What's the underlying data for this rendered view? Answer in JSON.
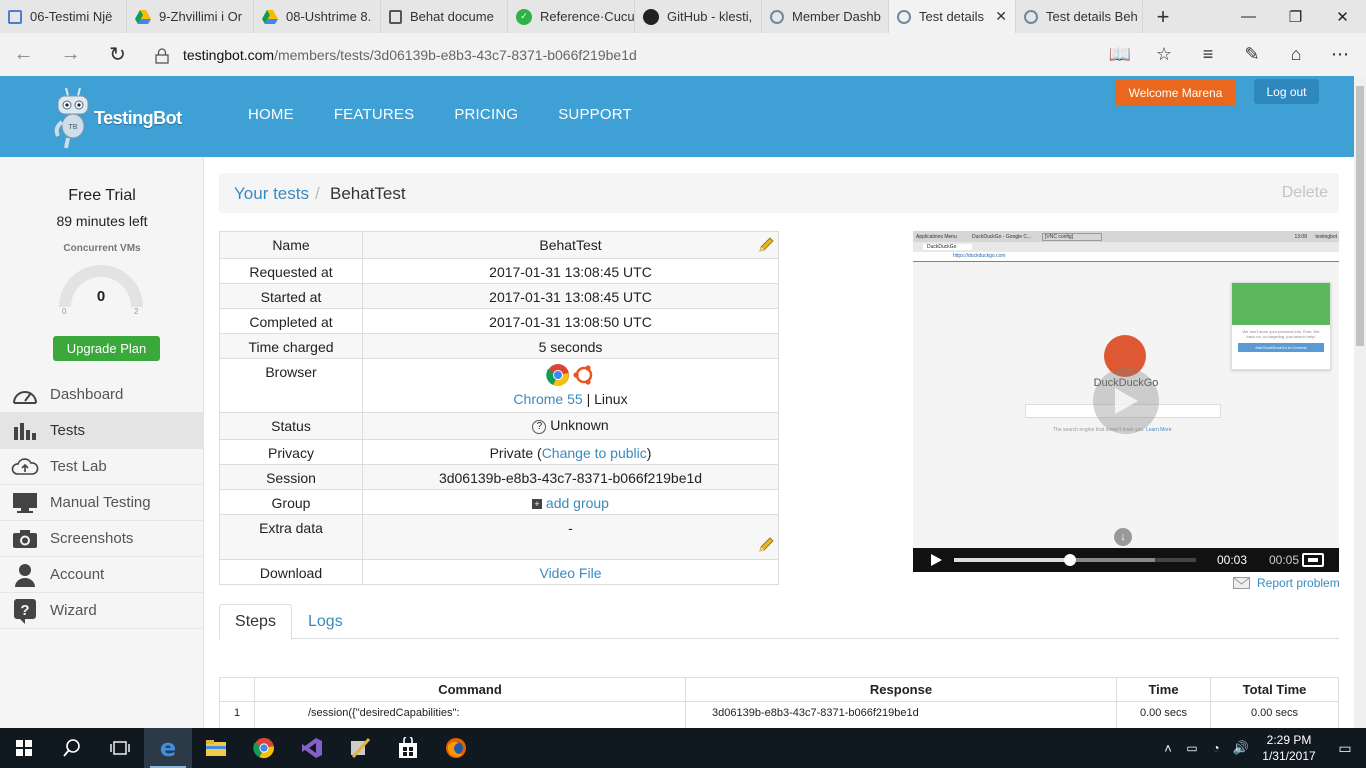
{
  "browser": {
    "tabs": [
      {
        "label": "06-Testimi Një",
        "icon": "docs-icon"
      },
      {
        "label": "9-Zhvillimi i Or",
        "icon": "drive-icon"
      },
      {
        "label": "08-Ushtrime 8.",
        "icon": "drive-icon"
      },
      {
        "label": "Behat docume",
        "icon": "book-icon"
      },
      {
        "label": "Reference·Cucu",
        "icon": "cucumber-icon"
      },
      {
        "label": "GitHub - klesti,",
        "icon": "github-icon"
      },
      {
        "label": "Member Dashb",
        "icon": "testingbot-icon"
      },
      {
        "label": "Test details",
        "icon": "testingbot-icon",
        "active": true
      },
      {
        "label": "Test details Beh",
        "icon": "testingbot-icon"
      }
    ],
    "url_host": "testingbot.com",
    "url_path": "/members/tests/3d06139b-e8b3-43c7-8371-b066f219be1d"
  },
  "site": {
    "brand": "TestingBot",
    "nav": [
      "HOME",
      "FEATURES",
      "PRICING",
      "SUPPORT"
    ],
    "welcome": "Welcome Marena",
    "logout": "Log out"
  },
  "sidebar": {
    "trial_title": "Free Trial",
    "trial_left": "89 minutes left",
    "cvm_label": "Concurrent VMs",
    "gauge_value": "0",
    "gauge_min": "0",
    "gauge_max": "2",
    "upgrade": "Upgrade Plan",
    "items": [
      {
        "label": "Dashboard",
        "icon": "speedometer-icon"
      },
      {
        "label": "Tests",
        "icon": "bar-chart-icon",
        "active": true
      },
      {
        "label": "Test Lab",
        "icon": "cloud-upload-icon"
      },
      {
        "label": "Manual Testing",
        "icon": "monitor-icon"
      },
      {
        "label": "Screenshots",
        "icon": "camera-icon"
      },
      {
        "label": "Account",
        "icon": "user-icon"
      },
      {
        "label": "Wizard",
        "icon": "question-icon"
      }
    ]
  },
  "breadcrumb": {
    "parent": "Your tests",
    "separator": "/",
    "current": "BehatTest",
    "delete": "Delete"
  },
  "details": {
    "name_label": "Name",
    "name": "BehatTest",
    "requested_label": "Requested at",
    "requested": "2017-01-31 13:08:45 UTC",
    "started_label": "Started at",
    "started": "2017-01-31 13:08:45 UTC",
    "completed_label": "Completed at",
    "completed": "2017-01-31 13:08:50 UTC",
    "charged_label": "Time charged",
    "charged": "5 seconds",
    "browser_label": "Browser",
    "browser_name": "Chrome 55",
    "browser_sep": "|",
    "os": "Linux",
    "status_label": "Status",
    "status": "Unknown",
    "privacy_label": "Privacy",
    "privacy_prefix": "Private (",
    "privacy_link": "Change to public",
    "privacy_suffix": ")",
    "session_label": "Session",
    "session": "3d06139b-e8b3-43c7-8371-b066f219be1d",
    "group_label": "Group",
    "group_link": "add group",
    "extra_label": "Extra data",
    "extra": "-",
    "download_label": "Download",
    "download_link": "Video File"
  },
  "video": {
    "current_time": "00:03",
    "duration": "00:05",
    "progress": 0.48,
    "buffered": 0.83,
    "report": "Report problem",
    "inner": {
      "tab1": "Applications Menu",
      "tab2": "DuckDuckGo - Google C...",
      "tab3": "[VNC config]",
      "time": "13:08",
      "host": "testingbot",
      "page_tab": "DuckDuckGo",
      "url": "https://duckduckgo.com",
      "brand": "DuckDuckGo",
      "popup_text": "We don't store your personal info. Ever. We track no, no targeting, just search help!",
      "popup_btn": "Add DuckDuckGo to Chrome",
      "tagline": "The search engine that doesn't track you.",
      "learn_more": "Learn More"
    }
  },
  "tabs": {
    "steps": "Steps",
    "logs": "Logs"
  },
  "steps": {
    "headers": [
      "",
      "Command",
      "Response",
      "Time",
      "Total Time"
    ],
    "rows": [
      {
        "num": "1",
        "command": "/session({\"desiredCapabilities\":",
        "response": "3d06139b-e8b3-43c7-8371-b066f219be1d",
        "time": "0.00 secs",
        "total": "0.00 secs"
      }
    ]
  },
  "taskbar": {
    "time": "2:29 PM",
    "date": "1/31/2017"
  }
}
